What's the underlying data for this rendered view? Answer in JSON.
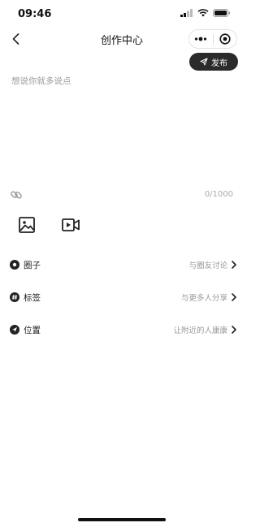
{
  "status_bar": {
    "time": "09:46",
    "icons": [
      "cellular-signal-icon",
      "wifi-icon",
      "battery-icon"
    ]
  },
  "nav": {
    "title": "创作中心",
    "back_icon": "chevron-left-icon",
    "capsule_icons": [
      "more-dots-icon",
      "close-circle-icon"
    ]
  },
  "publish": {
    "label": "发布",
    "icon": "send-icon"
  },
  "editor": {
    "placeholder": "想说你就多说点",
    "value": "",
    "counter": "0/1000",
    "link_icon": "link-icon"
  },
  "media": {
    "icons": [
      "image-icon",
      "video-icon"
    ]
  },
  "options": [
    {
      "label": "圈子",
      "hint": "与圈友讨论",
      "icon": "circle-icon"
    },
    {
      "label": "标签",
      "hint": "与更多人分享",
      "icon": "hashtag-icon"
    },
    {
      "label": "位置",
      "hint": "让附近的人康康",
      "icon": "location-icon"
    }
  ],
  "colors": {
    "accent": "#2b2b2b",
    "placeholder": "#9a9a9a",
    "hint": "#999999",
    "background": "#ffffff"
  }
}
